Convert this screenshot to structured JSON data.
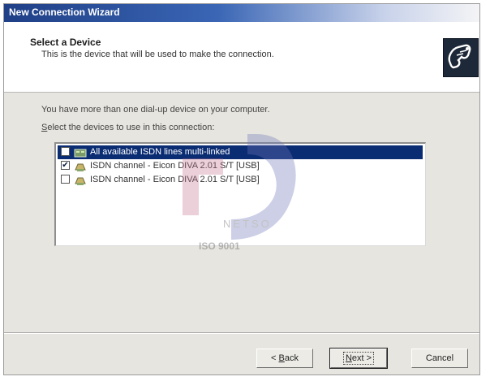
{
  "window": {
    "title": "New Connection Wizard"
  },
  "header": {
    "title": "Select a Device",
    "subtitle": "This is the device that will be used to make the connection."
  },
  "body": {
    "intro_text": "You have more than one dial-up device on your computer.",
    "select_prefix": "S",
    "select_rest": "elect the devices to use in this connection:"
  },
  "devices": [
    {
      "label": "All available ISDN lines multi-linked",
      "checked": false,
      "selected": true
    },
    {
      "label": "ISDN  channel - Eicon DIVA 2.01 S/T [USB]",
      "checked": true,
      "selected": false
    },
    {
      "label": "ISDN  channel - Eicon DIVA 2.01 S/T [USB]",
      "checked": false,
      "selected": false
    }
  ],
  "watermark": {
    "word": "NETSO",
    "cert": "ISO 9001"
  },
  "buttons": {
    "back_prefix": "< ",
    "back_mnemonic": "B",
    "back_rest": "ack",
    "next_mnemonic": "N",
    "next_rest": "ext >",
    "cancel": "Cancel"
  },
  "colors": {
    "title_bar": "#1f3f86",
    "selection": "#0a2c73",
    "dialog_bg": "#e7e5df"
  }
}
